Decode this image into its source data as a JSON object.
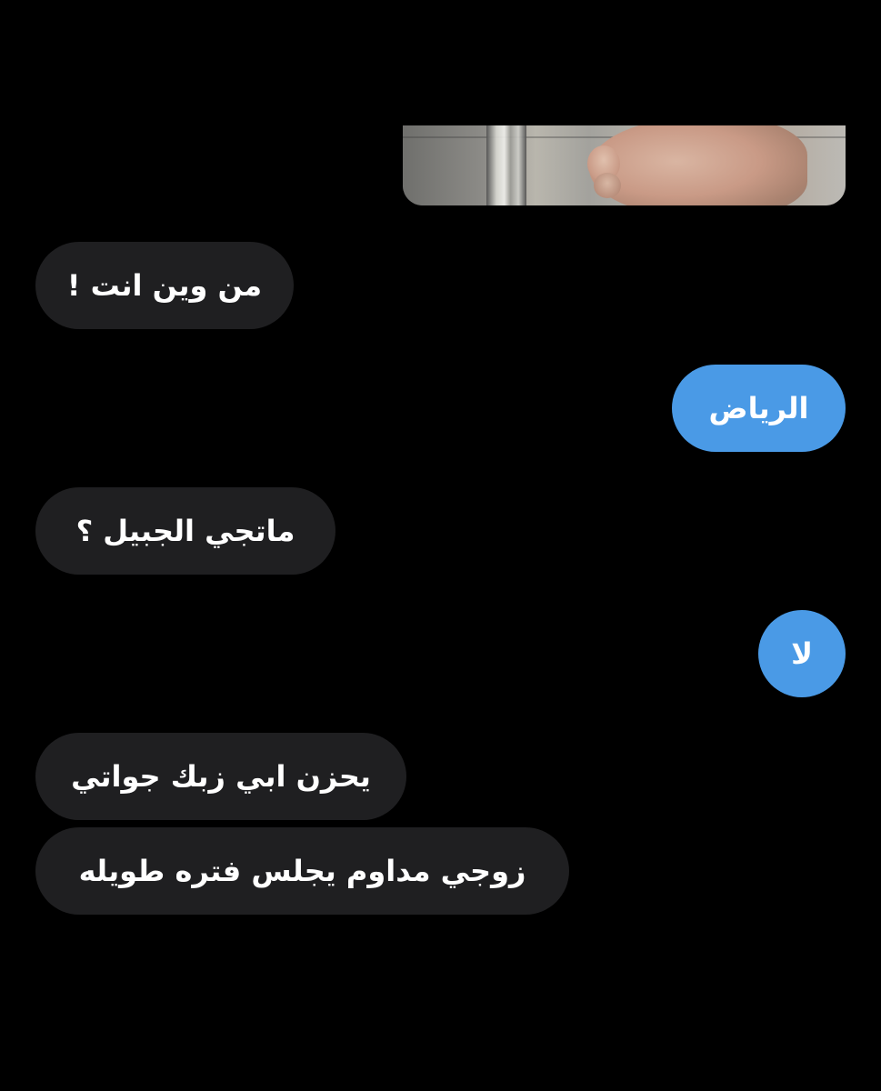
{
  "conversation": {
    "photo": {
      "icon": "photo-attachment",
      "description_colors": {
        "skin": "#c99a86",
        "floor": "#9e9d98",
        "pole": "#e6e6e1"
      }
    },
    "messages": [
      {
        "sender": "other",
        "text": "من وين انت !"
      },
      {
        "sender": "me",
        "text": "الرياض"
      },
      {
        "sender": "other",
        "text": "ماتجي الجبيل ؟"
      },
      {
        "sender": "me",
        "text": "لا"
      },
      {
        "sender": "other",
        "text": "يحزن ابي زبك جواتي"
      },
      {
        "sender": "other",
        "text": "زوجي مداوم يجلس فتره طويله"
      }
    ]
  },
  "colors": {
    "background": "#000000",
    "incoming_bubble": "#1f1f21",
    "outgoing_bubble": "#4a9ae6",
    "text": "#ffffff"
  }
}
